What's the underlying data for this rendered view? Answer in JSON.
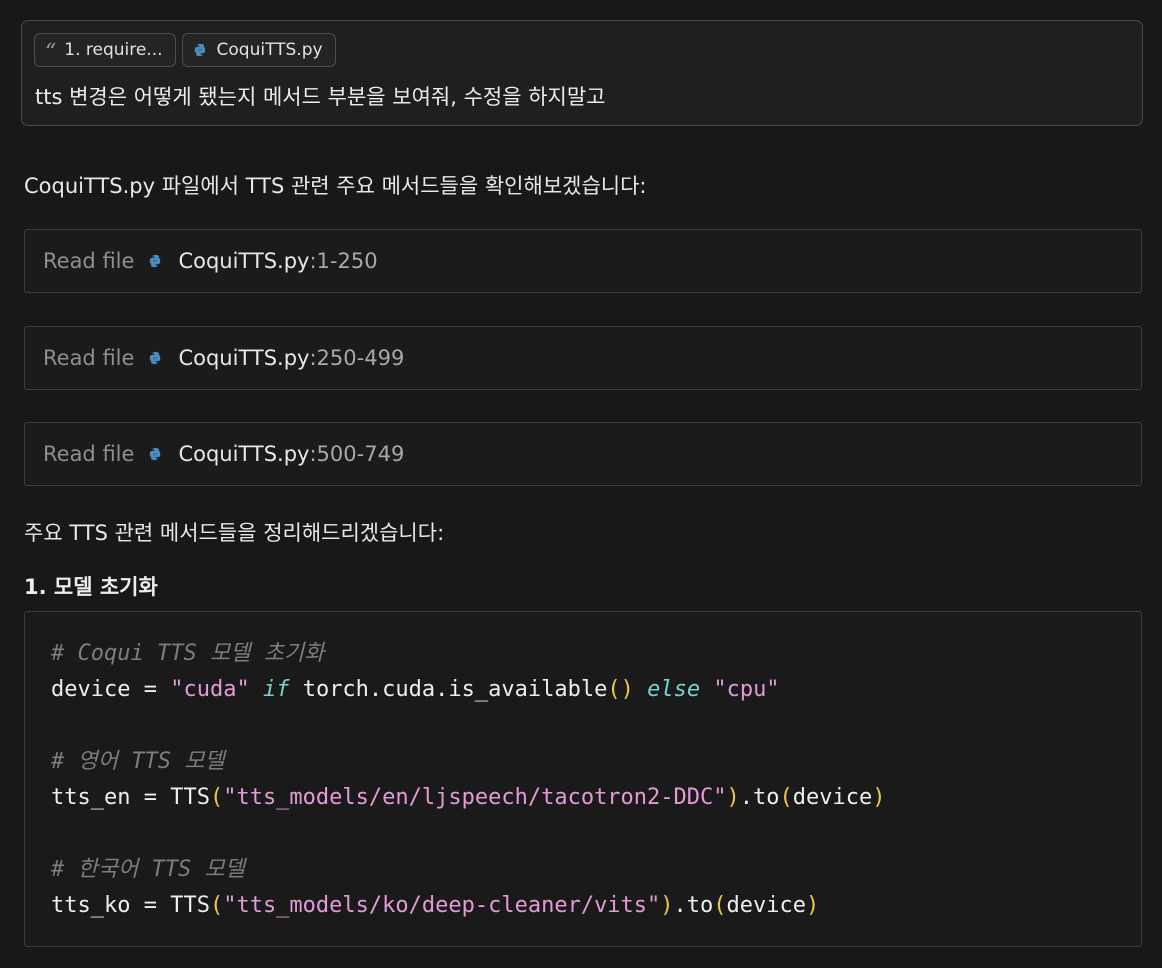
{
  "user_message": {
    "chips": [
      {
        "label": "1. require...",
        "icon": "quote-icon"
      },
      {
        "label": "CoquiTTS.py",
        "icon": "python-file-icon"
      }
    ],
    "text": "tts 변경은 어떻게 됐는지 메서드 부분을 보여줘, 수정을 하지말고"
  },
  "assistant": {
    "intro": "CoquiTTS.py 파일에서 TTS 관련 주요 메서드들을 확인해보겠습니다:",
    "read_files": [
      {
        "label": "Read file",
        "file": "CoquiTTS.py",
        "range": ":1-250"
      },
      {
        "label": "Read file",
        "file": "CoquiTTS.py",
        "range": ":250-499"
      },
      {
        "label": "Read file",
        "file": "CoquiTTS.py",
        "range": ":500-749"
      }
    ],
    "summary": "주요 TTS 관련 메서드들을 정리해드리겠습니다:",
    "section_heading": "1. 모델 초기화",
    "code": {
      "line1_comment": "# Coqui TTS 모델 초기화",
      "line2": {
        "a": "device = ",
        "str1": "\"cuda\"",
        "kw_if": "if",
        "b": " torch.cuda.is_available",
        "paren": "()",
        "kw_else": "else",
        "str2": "\"cpu\""
      },
      "line4_comment": "# 영어 TTS 모델",
      "line5": {
        "a": "tts_en = TTS",
        "open": "(",
        "str": "\"tts_models/en/ljspeech/tacotron2-DDC\"",
        "close": ")",
        "b": ".to",
        "open2": "(",
        "arg": "device",
        "close2": ")"
      },
      "line7_comment": "# 한국어 TTS 모델",
      "line8": {
        "a": "tts_ko = TTS",
        "open": "(",
        "str": "\"tts_models/ko/deep-cleaner/vits\"",
        "close": ")",
        "b": ".to",
        "open2": "(",
        "arg": "device",
        "close2": ")"
      }
    }
  },
  "colors": {
    "background": "#181818",
    "python_icon": "#4b8bbe",
    "code_string": "#e39bd6",
    "code_keyword": "#76d4cf",
    "code_paren": "#f0c845",
    "code_comment": "#7d7d7d"
  }
}
